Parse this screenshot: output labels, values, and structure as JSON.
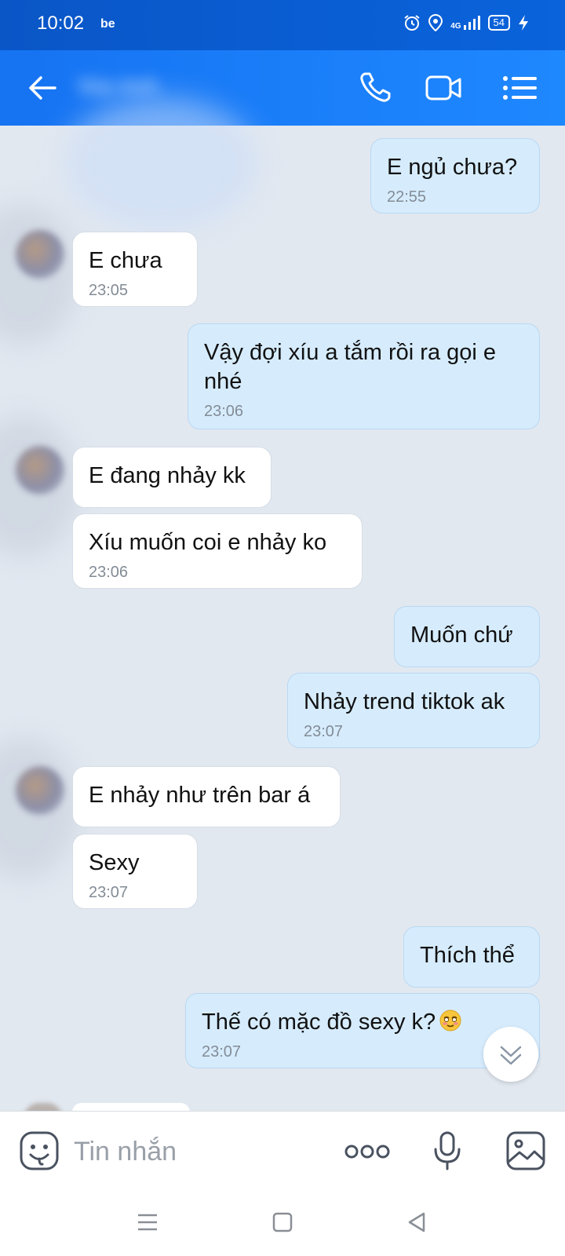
{
  "status_bar": {
    "time": "10:02",
    "app_badge": "be",
    "network": "4G",
    "battery": "54"
  },
  "header": {
    "contact_name": "Mai Anh"
  },
  "messages": [
    {
      "dir": "out",
      "text": "E ngủ chưa?",
      "time": "22:55"
    },
    {
      "dir": "in",
      "text": "E chưa",
      "time": "23:05"
    },
    {
      "dir": "out",
      "text": "Vậy đợi xíu a tắm rồi ra gọi e nhé",
      "time": "23:06"
    },
    {
      "dir": "in",
      "text": "E đang nhảy kk",
      "time": ""
    },
    {
      "dir": "in",
      "text": "Xíu muốn coi e nhảy ko",
      "time": "23:06"
    },
    {
      "dir": "out",
      "text": "Muốn chứ",
      "time": ""
    },
    {
      "dir": "out",
      "text": "Nhảy trend tiktok ak",
      "time": "23:07"
    },
    {
      "dir": "in",
      "text": "E nhảy như trên bar á",
      "time": ""
    },
    {
      "dir": "in",
      "text": "Sexy",
      "time": "23:07"
    },
    {
      "dir": "out",
      "text": "Thích thể",
      "time": ""
    },
    {
      "dir": "out",
      "text": "Thế có mặc đồ sexy k?",
      "time": "23:07"
    }
  ],
  "input": {
    "placeholder": "Tin nhắn"
  },
  "icons": {
    "back": "arrow-left-icon",
    "call": "phone-icon",
    "video": "video-camera-icon",
    "menu": "list-icon",
    "sticker": "sticker-face-icon",
    "more": "more-dots-icon",
    "mic": "microphone-icon",
    "image": "image-icon",
    "scroll": "chevron-double-down-icon"
  },
  "colors": {
    "header": "#1e88ff",
    "outgoing_bubble": "#d6ecfd",
    "incoming_bubble": "#ffffff",
    "background": "#e2e8f0"
  }
}
